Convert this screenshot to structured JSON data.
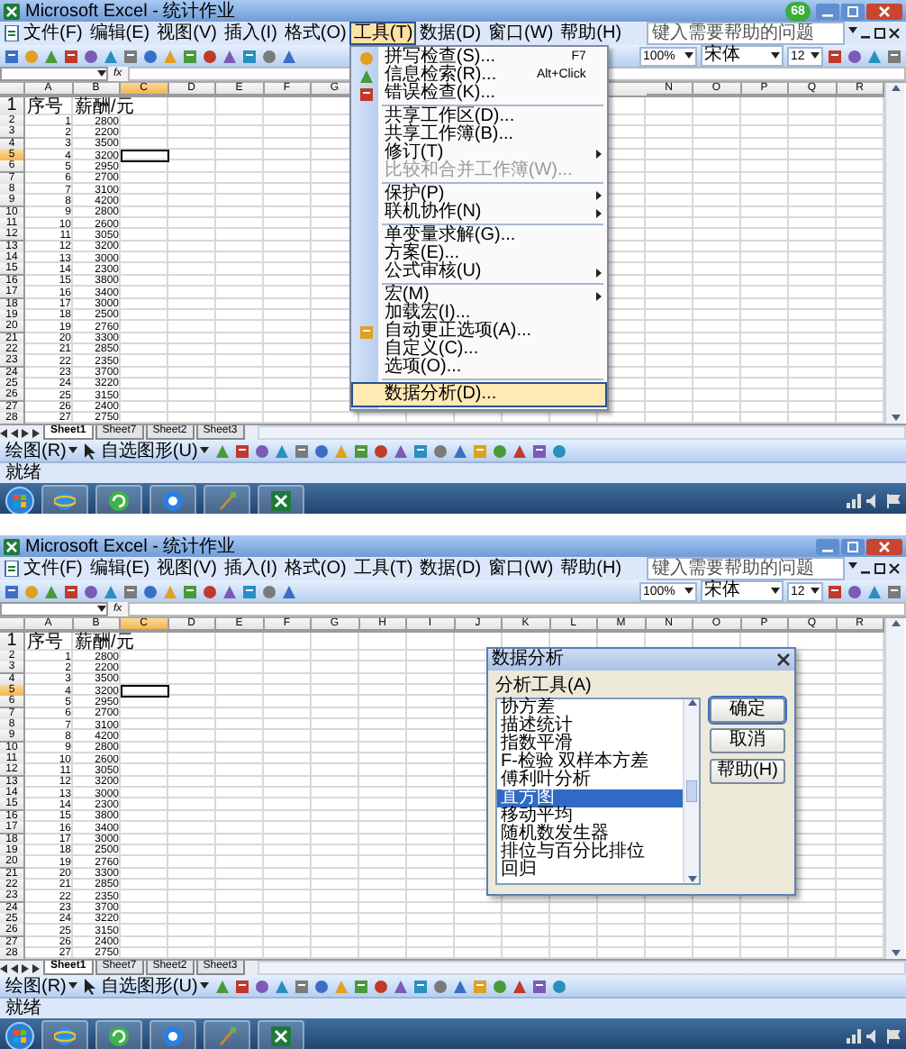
{
  "screens": [
    {
      "title": "Microsoft Excel - 统计作业",
      "badge": "68",
      "menus": [
        {
          "label": "文件(F)",
          "open": false
        },
        {
          "label": "编辑(E)",
          "open": false
        },
        {
          "label": "视图(V)",
          "open": false
        },
        {
          "label": "插入(I)",
          "open": false
        },
        {
          "label": "格式(O)",
          "open": false
        },
        {
          "label": "工具(T)",
          "open": true
        },
        {
          "label": "数据(D)",
          "open": false
        },
        {
          "label": "窗口(W)",
          "open": false
        },
        {
          "label": "帮助(H)",
          "open": false
        }
      ],
      "help_placeholder": "键入需要帮助的问题",
      "zoom": "100%",
      "font": "宋体",
      "font_size": "12",
      "formula_label": "fx",
      "tools_menu": {
        "groups": [
          [
            {
              "label": "拼写检查(S)...",
              "shortcut": "F7",
              "icon": true,
              "submenu": false,
              "disabled": false,
              "selected": false
            },
            {
              "label": "信息检索(R)...",
              "shortcut": "Alt+Click",
              "icon": true,
              "submenu": false,
              "disabled": false,
              "selected": false
            },
            {
              "label": "错误检查(K)...",
              "icon": true,
              "submenu": false,
              "disabled": false,
              "selected": false
            }
          ],
          [
            {
              "label": "共享工作区(D)...",
              "icon": false,
              "submenu": false,
              "disabled": false,
              "selected": false
            },
            {
              "label": "共享工作簿(B)...",
              "icon": false,
              "submenu": false,
              "disabled": false,
              "selected": false
            },
            {
              "label": "修订(T)",
              "icon": false,
              "submenu": true,
              "disabled": false,
              "selected": false
            },
            {
              "label": "比较和合并工作簿(W)...",
              "icon": false,
              "submenu": false,
              "disabled": true,
              "selected": false
            }
          ],
          [
            {
              "label": "保护(P)",
              "icon": false,
              "submenu": true,
              "disabled": false,
              "selected": false
            },
            {
              "label": "联机协作(N)",
              "icon": false,
              "submenu": true,
              "disabled": false,
              "selected": false
            }
          ],
          [
            {
              "label": "单变量求解(G)...",
              "icon": false,
              "submenu": false,
              "disabled": false,
              "selected": false
            },
            {
              "label": "方案(E)...",
              "icon": false,
              "submenu": false,
              "disabled": false,
              "selected": false
            },
            {
              "label": "公式审核(U)",
              "icon": false,
              "submenu": true,
              "disabled": false,
              "selected": false
            }
          ],
          [
            {
              "label": "宏(M)",
              "icon": false,
              "submenu": true,
              "disabled": false,
              "selected": false
            },
            {
              "label": "加载宏(I)...",
              "icon": false,
              "submenu": false,
              "disabled": false,
              "selected": false
            },
            {
              "label": "自动更正选项(A)...",
              "icon": true,
              "submenu": false,
              "disabled": false,
              "selected": false
            },
            {
              "label": "自定义(C)...",
              "icon": false,
              "submenu": false,
              "disabled": false,
              "selected": false
            },
            {
              "label": "选项(O)...",
              "icon": false,
              "submenu": false,
              "disabled": false,
              "selected": false
            }
          ],
          [
            {
              "label": "数据分析(D)...",
              "icon": false,
              "submenu": false,
              "disabled": false,
              "selected": true
            }
          ]
        ]
      },
      "columns_left": [
        {
          "label": "A",
          "selected": false
        },
        {
          "label": "B",
          "selected": false
        },
        {
          "label": "C",
          "selected": true
        },
        {
          "label": "D",
          "selected": false
        },
        {
          "label": "E",
          "selected": false
        },
        {
          "label": "F",
          "selected": false
        },
        {
          "label": "G",
          "selected": false
        }
      ],
      "columns_right": [
        {
          "label": "N",
          "selected": false
        },
        {
          "label": "O",
          "selected": false
        },
        {
          "label": "P",
          "selected": false
        },
        {
          "label": "Q",
          "selected": false
        },
        {
          "label": "R",
          "selected": false
        }
      ],
      "rows": [
        {
          "label": "1",
          "kind": "text",
          "cells": [
            "序号",
            "薪酬/元"
          ],
          "selected": false
        },
        {
          "label": "2",
          "kind": "number",
          "cells": [
            "1",
            "2800"
          ],
          "selected": false
        },
        {
          "label": "3",
          "kind": "number",
          "cells": [
            "2",
            "2200"
          ],
          "selected": false
        },
        {
          "label": "4",
          "kind": "number",
          "cells": [
            "3",
            "3500"
          ],
          "selected": false
        },
        {
          "label": "5",
          "kind": "number",
          "cells": [
            "4",
            "3200"
          ],
          "selected": true
        },
        {
          "label": "6",
          "kind": "number",
          "cells": [
            "5",
            "2950"
          ],
          "selected": false
        },
        {
          "label": "7",
          "kind": "number",
          "cells": [
            "6",
            "2700"
          ],
          "selected": false
        },
        {
          "label": "8",
          "kind": "number",
          "cells": [
            "7",
            "3100"
          ],
          "selected": false
        },
        {
          "label": "9",
          "kind": "number",
          "cells": [
            "8",
            "4200"
          ],
          "selected": false
        },
        {
          "label": "10",
          "kind": "number",
          "cells": [
            "9",
            "2800"
          ],
          "selected": false
        },
        {
          "label": "11",
          "kind": "number",
          "cells": [
            "10",
            "2600"
          ],
          "selected": false
        },
        {
          "label": "12",
          "kind": "number",
          "cells": [
            "11",
            "3050"
          ],
          "selected": false
        },
        {
          "label": "13",
          "kind": "number",
          "cells": [
            "12",
            "3200"
          ],
          "selected": false
        },
        {
          "label": "14",
          "kind": "number",
          "cells": [
            "13",
            "3000"
          ],
          "selected": false
        },
        {
          "label": "15",
          "kind": "number",
          "cells": [
            "14",
            "2300"
          ],
          "selected": false
        },
        {
          "label": "16",
          "kind": "number",
          "cells": [
            "15",
            "3800"
          ],
          "selected": false
        },
        {
          "label": "17",
          "kind": "number",
          "cells": [
            "16",
            "3400"
          ],
          "selected": false
        },
        {
          "label": "18",
          "kind": "number",
          "cells": [
            "17",
            "3000"
          ],
          "selected": false
        },
        {
          "label": "19",
          "kind": "number",
          "cells": [
            "18",
            "2500"
          ],
          "selected": false
        },
        {
          "label": "20",
          "kind": "number",
          "cells": [
            "19",
            "2760"
          ],
          "selected": false
        },
        {
          "label": "21",
          "kind": "number",
          "cells": [
            "20",
            "3300"
          ],
          "selected": false
        },
        {
          "label": "22",
          "kind": "number",
          "cells": [
            "21",
            "2850"
          ],
          "selected": false
        },
        {
          "label": "23",
          "kind": "number",
          "cells": [
            "22",
            "2350"
          ],
          "selected": false
        },
        {
          "label": "24",
          "kind": "number",
          "cells": [
            "23",
            "3700"
          ],
          "selected": false
        },
        {
          "label": "25",
          "kind": "number",
          "cells": [
            "24",
            "3220"
          ],
          "selected": false
        },
        {
          "label": "26",
          "kind": "number",
          "cells": [
            "25",
            "3150"
          ],
          "selected": false
        },
        {
          "label": "27",
          "kind": "number",
          "cells": [
            "26",
            "2400"
          ],
          "selected": false
        },
        {
          "label": "28",
          "kind": "number",
          "cells": [
            "27",
            "2750"
          ],
          "selected": false
        }
      ],
      "sheet_tabs": [
        {
          "label": "Sheet1",
          "selected": true
        },
        {
          "label": "Sheet7",
          "selected": false
        },
        {
          "label": "Sheet2",
          "selected": false
        },
        {
          "label": "Sheet3",
          "selected": false
        }
      ],
      "draw_menu": "绘图(R)",
      "autoshapes_menu": "自选图形(U)",
      "status": "就绪"
    },
    {
      "title": "Microsoft Excel - 统计作业",
      "menus": [
        {
          "label": "文件(F)",
          "open": false
        },
        {
          "label": "编辑(E)",
          "open": false
        },
        {
          "label": "视图(V)",
          "open": false
        },
        {
          "label": "插入(I)",
          "open": false
        },
        {
          "label": "格式(O)",
          "open": false
        },
        {
          "label": "工具(T)",
          "open": false
        },
        {
          "label": "数据(D)",
          "open": false
        },
        {
          "label": "窗口(W)",
          "open": false
        },
        {
          "label": "帮助(H)",
          "open": false
        }
      ],
      "help_placeholder": "键入需要帮助的问题",
      "zoom": "100%",
      "font": "宋体",
      "font_size": "12",
      "formula_label": "fx",
      "columns_left": [
        {
          "label": "A",
          "selected": false
        },
        {
          "label": "B",
          "selected": false
        },
        {
          "label": "C",
          "selected": true
        },
        {
          "label": "D",
          "selected": false
        },
        {
          "label": "E",
          "selected": false
        },
        {
          "label": "F",
          "selected": false
        },
        {
          "label": "G",
          "selected": false
        },
        {
          "label": "H",
          "selected": false
        },
        {
          "label": "I",
          "selected": false
        },
        {
          "label": "J",
          "selected": false
        },
        {
          "label": "K",
          "selected": false
        },
        {
          "label": "L",
          "selected": false
        },
        {
          "label": "M",
          "selected": false
        },
        {
          "label": "N",
          "selected": false
        },
        {
          "label": "O",
          "selected": false
        },
        {
          "label": "P",
          "selected": false
        },
        {
          "label": "Q",
          "selected": false
        },
        {
          "label": "R",
          "selected": false
        }
      ],
      "rows": [
        {
          "label": "1",
          "kind": "text",
          "cells": [
            "序号",
            "薪酬/元"
          ],
          "selected": false
        },
        {
          "label": "2",
          "kind": "number",
          "cells": [
            "1",
            "2800"
          ],
          "selected": false
        },
        {
          "label": "3",
          "kind": "number",
          "cells": [
            "2",
            "2200"
          ],
          "selected": false
        },
        {
          "label": "4",
          "kind": "number",
          "cells": [
            "3",
            "3500"
          ],
          "selected": false
        },
        {
          "label": "5",
          "kind": "number",
          "cells": [
            "4",
            "3200"
          ],
          "selected": true
        },
        {
          "label": "6",
          "kind": "number",
          "cells": [
            "5",
            "2950"
          ],
          "selected": false
        },
        {
          "label": "7",
          "kind": "number",
          "cells": [
            "6",
            "2700"
          ],
          "selected": false
        },
        {
          "label": "8",
          "kind": "number",
          "cells": [
            "7",
            "3100"
          ],
          "selected": false
        },
        {
          "label": "9",
          "kind": "number",
          "cells": [
            "8",
            "4200"
          ],
          "selected": false
        },
        {
          "label": "10",
          "kind": "number",
          "cells": [
            "9",
            "2800"
          ],
          "selected": false
        },
        {
          "label": "11",
          "kind": "number",
          "cells": [
            "10",
            "2600"
          ],
          "selected": false
        },
        {
          "label": "12",
          "kind": "number",
          "cells": [
            "11",
            "3050"
          ],
          "selected": false
        },
        {
          "label": "13",
          "kind": "number",
          "cells": [
            "12",
            "3200"
          ],
          "selected": false
        },
        {
          "label": "14",
          "kind": "number",
          "cells": [
            "13",
            "3000"
          ],
          "selected": false
        },
        {
          "label": "15",
          "kind": "number",
          "cells": [
            "14",
            "2300"
          ],
          "selected": false
        },
        {
          "label": "16",
          "kind": "number",
          "cells": [
            "15",
            "3800"
          ],
          "selected": false
        },
        {
          "label": "17",
          "kind": "number",
          "cells": [
            "16",
            "3400"
          ],
          "selected": false
        },
        {
          "label": "18",
          "kind": "number",
          "cells": [
            "17",
            "3000"
          ],
          "selected": false
        },
        {
          "label": "19",
          "kind": "number",
          "cells": [
            "18",
            "2500"
          ],
          "selected": false
        },
        {
          "label": "20",
          "kind": "number",
          "cells": [
            "19",
            "2760"
          ],
          "selected": false
        },
        {
          "label": "21",
          "kind": "number",
          "cells": [
            "20",
            "3300"
          ],
          "selected": false
        },
        {
          "label": "22",
          "kind": "number",
          "cells": [
            "21",
            "2850"
          ],
          "selected": false
        },
        {
          "label": "23",
          "kind": "number",
          "cells": [
            "22",
            "2350"
          ],
          "selected": false
        },
        {
          "label": "24",
          "kind": "number",
          "cells": [
            "23",
            "3700"
          ],
          "selected": false
        },
        {
          "label": "25",
          "kind": "number",
          "cells": [
            "24",
            "3220"
          ],
          "selected": false
        },
        {
          "label": "26",
          "kind": "number",
          "cells": [
            "25",
            "3150"
          ],
          "selected": false
        },
        {
          "label": "27",
          "kind": "number",
          "cells": [
            "26",
            "2400"
          ],
          "selected": false
        },
        {
          "label": "28",
          "kind": "number",
          "cells": [
            "27",
            "2750"
          ],
          "selected": false
        }
      ],
      "sheet_tabs": [
        {
          "label": "Sheet1",
          "selected": true
        },
        {
          "label": "Sheet7",
          "selected": false
        },
        {
          "label": "Sheet2",
          "selected": false
        },
        {
          "label": "Sheet3",
          "selected": false
        }
      ],
      "draw_menu": "绘图(R)",
      "autoshapes_menu": "自选图形(U)",
      "status": "就绪",
      "dialog": {
        "title": "数据分析",
        "list_label": "分析工具(A)",
        "items": [
          {
            "label": "协方差",
            "selected": false
          },
          {
            "label": "描述统计",
            "selected": false
          },
          {
            "label": "指数平滑",
            "selected": false
          },
          {
            "label": "F-检验 双样本方差",
            "selected": false
          },
          {
            "label": "傅利叶分析",
            "selected": false
          },
          {
            "label": "直方图",
            "selected": true
          },
          {
            "label": "移动平均",
            "selected": false
          },
          {
            "label": "随机数发生器",
            "selected": false
          },
          {
            "label": "排位与百分比排位",
            "selected": false
          },
          {
            "label": "回归",
            "selected": false
          }
        ],
        "buttons": [
          "确定",
          "取消",
          "帮助(H)"
        ]
      }
    }
  ]
}
